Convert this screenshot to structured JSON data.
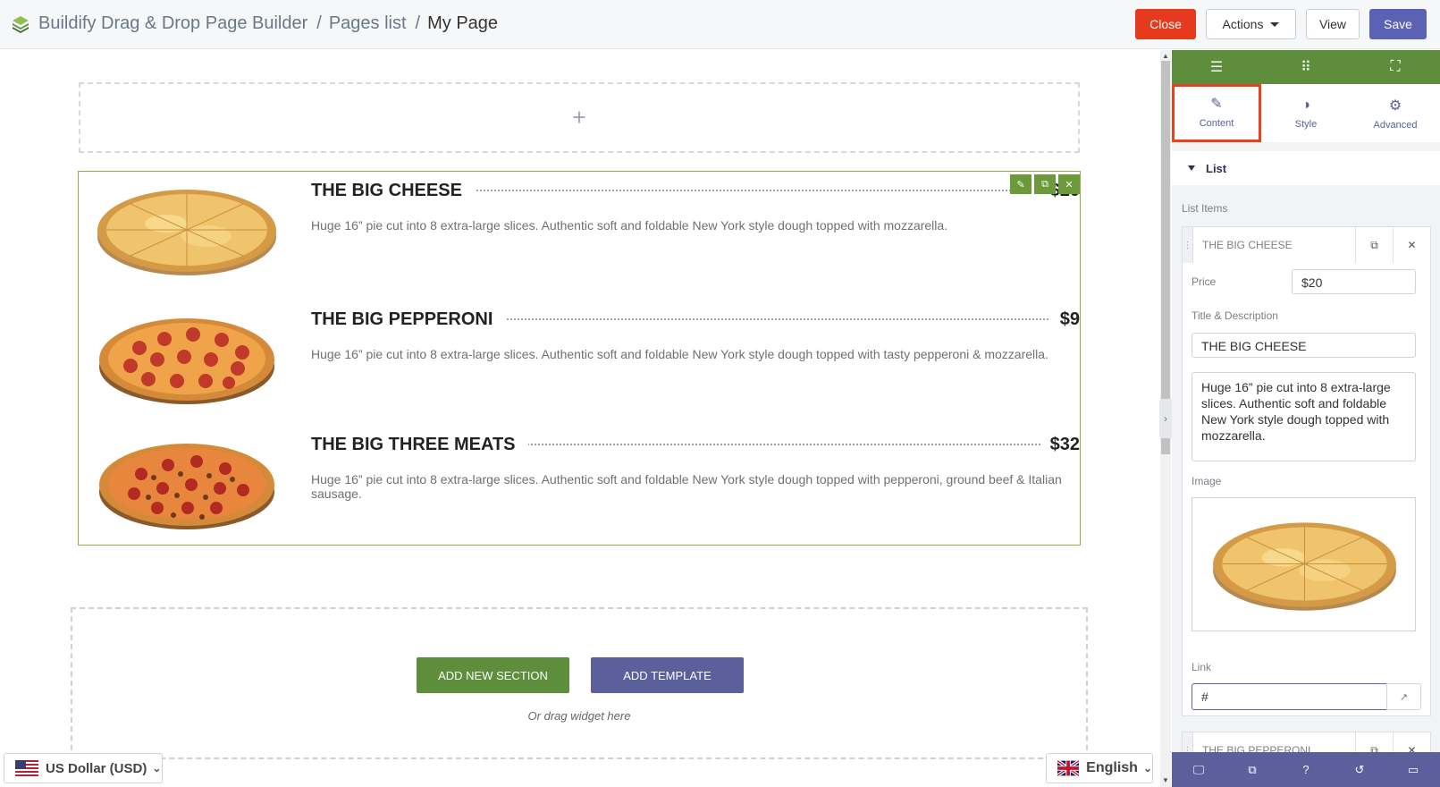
{
  "header": {
    "breadcrumb": [
      "Buildify Drag & Drop Page Builder",
      "Pages list",
      "My Page"
    ],
    "separator": "/",
    "buttons": {
      "close": "Close",
      "actions": "Actions",
      "view": "View",
      "save": "Save"
    }
  },
  "canvas": {
    "add_icon": "+",
    "menu_items": [
      {
        "title": "THE BIG CHEESE",
        "price": "$20",
        "description": "Huge 16” pie cut into 8 extra-large slices. Authentic soft and foldable New York style dough topped with mozzarella.",
        "pizza": "cheese"
      },
      {
        "title": "THE BIG PEPPERONI",
        "price": "$9",
        "description": "Huge 16” pie cut into 8 extra-large slices. Authentic soft and foldable New York style dough topped with tasty pepperoni & mozzarella.",
        "pizza": "pepperoni"
      },
      {
        "title": "THE BIG THREE MEATS",
        "price": "$32",
        "description": "Huge 16” pie cut into 8 extra-large slices. Authentic soft and foldable New York style dough topped with pepperoni, ground beef & Italian sausage.",
        "pizza": "meats"
      }
    ],
    "widget_tools": [
      "edit-icon",
      "duplicate-icon",
      "remove-icon"
    ],
    "add_section_label": "ADD NEW SECTION",
    "add_template_label": "ADD TEMPLATE",
    "drag_hint": "Or drag widget here"
  },
  "footer": {
    "currency": "US Dollar (USD)",
    "language": "English"
  },
  "panel": {
    "top_icons": [
      "menu-icon",
      "grid-icon",
      "sitemap-icon"
    ],
    "tabs": [
      {
        "label": "Content",
        "icon": "pencil-icon",
        "active": true
      },
      {
        "label": "Style",
        "icon": "contrast-icon",
        "active": false
      },
      {
        "label": "Advanced",
        "icon": "gear-icon",
        "active": false
      }
    ],
    "section_title": "List",
    "list_items_label": "List Items",
    "item1": {
      "title": "THE BIG CHEESE",
      "price_label": "Price",
      "price": "$20",
      "title_desc_label": "Title & Description",
      "title_value": "THE BIG CHEESE",
      "desc_value": "Huge 16” pie cut into 8 extra-large slices. Authentic soft and foldable New York style dough topped with mozzarella.",
      "image_label": "Image",
      "link_label": "Link",
      "link_value": "#"
    },
    "item2_title": "THE BIG PEPPERONI",
    "bottom_icons": [
      "desktop-icon",
      "responsive-icon",
      "help-icon",
      "history-icon",
      "folder-icon"
    ]
  }
}
